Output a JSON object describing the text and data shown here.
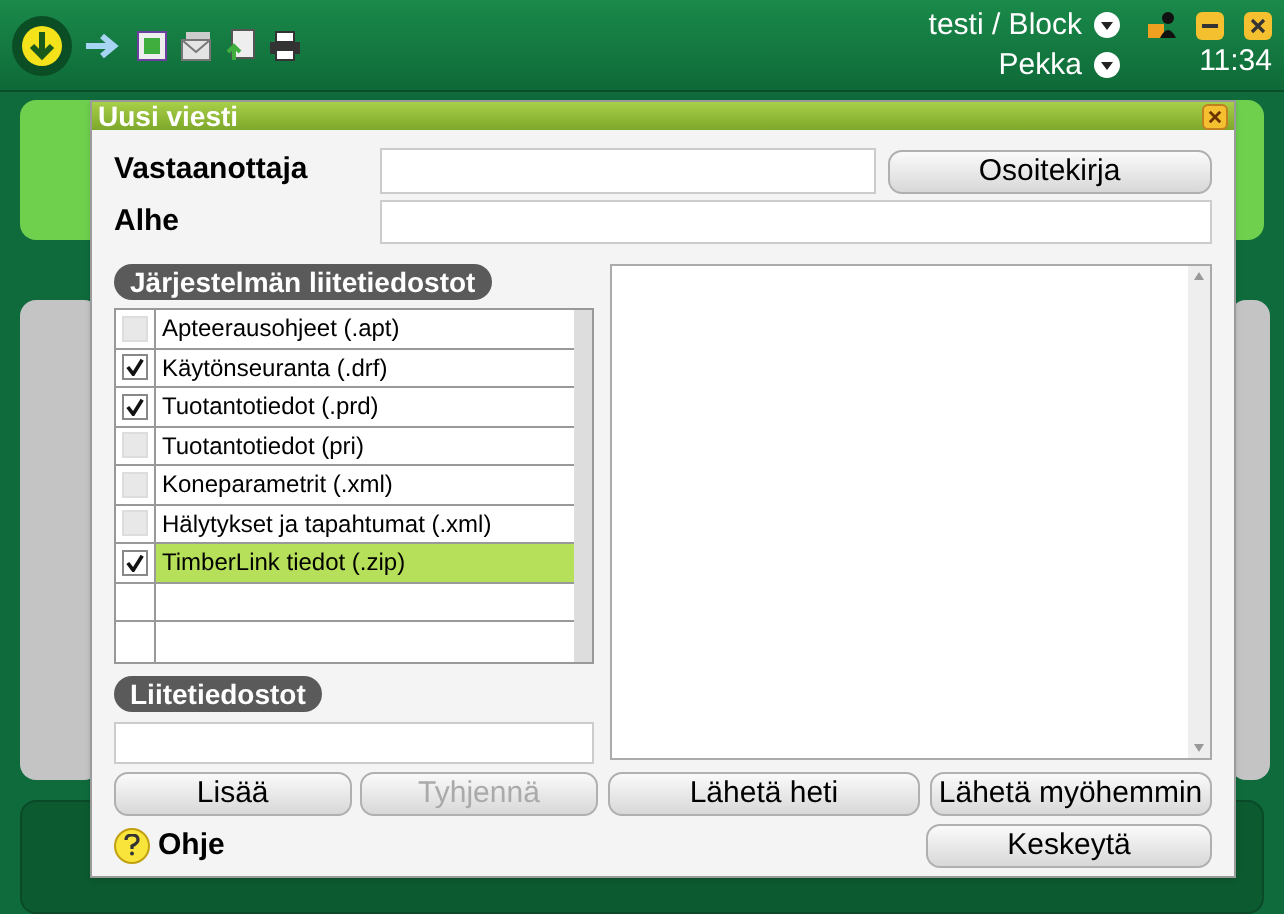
{
  "top_bar": {
    "account": "testi / Block",
    "operator": "Pekka",
    "time": "11:34"
  },
  "dialog": {
    "title": "Uusi viesti",
    "recipient": {
      "label": "Vastaanottaja"
    },
    "address_book_button": "Osoitekirja",
    "subject": {
      "label": "Alhe"
    },
    "system_attachments": {
      "heading": "Järjestelmän liitetiedostot",
      "items": [
        {
          "label": "Apteerausohjeet (.apt)",
          "checked": false,
          "selected": false
        },
        {
          "label": "Käytönseuranta (.drf)",
          "checked": true,
          "selected": false
        },
        {
          "label": "Tuotantotiedot (.prd)",
          "checked": true,
          "selected": false
        },
        {
          "label": "Tuotantotiedot (pri)",
          "checked": false,
          "selected": false
        },
        {
          "label": "Koneparametrit (.xml)",
          "checked": false,
          "selected": false
        },
        {
          "label": "Hälytykset ja tapahtumat (.xml)",
          "checked": false,
          "selected": false
        },
        {
          "label": "TimberLink tiedot (.zip)",
          "checked": true,
          "selected": true
        }
      ]
    },
    "attachments": {
      "heading": "Liitetiedostot"
    },
    "buttons": [
      {
        "label": "Lisää",
        "disabled": false
      },
      {
        "label": "Tyhjennä",
        "disabled": true
      },
      {
        "label": "Lähetä heti",
        "disabled": false
      },
      {
        "label": "Lähetä myöhemmin",
        "disabled": false
      }
    ],
    "help": "Ohje",
    "cancel_button": "Keskeytä"
  }
}
